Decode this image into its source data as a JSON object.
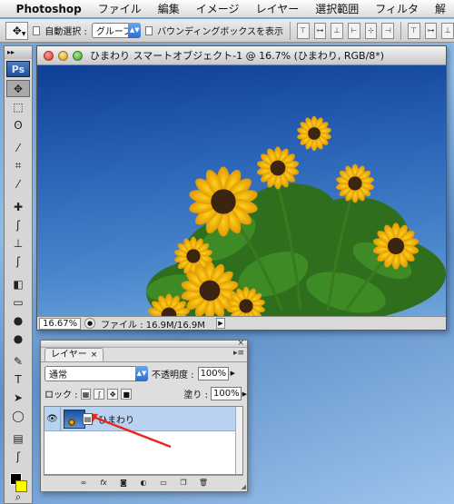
{
  "menubar": {
    "apple_icon": "apple-icon",
    "app_name": "Photoshop",
    "items": [
      "ファイル",
      "編集",
      "イメージ",
      "レイヤー",
      "選択範囲",
      "フィルタ",
      "解"
    ]
  },
  "options_bar": {
    "auto_select_label": "自動選択 :",
    "auto_select_value": "グループ",
    "bounding_box_label": "バウンディングボックスを表示"
  },
  "toolbox": {
    "logo": "Ps",
    "tools": [
      {
        "name": "move-tool",
        "glyph": "✥"
      },
      {
        "name": "marquee-tool",
        "glyph": "⬚"
      },
      {
        "name": "lasso-tool",
        "glyph": "ʘ"
      },
      {
        "name": "magic-wand-tool",
        "glyph": "⁄"
      },
      {
        "name": "crop-tool",
        "glyph": "⌗"
      },
      {
        "name": "slice-tool",
        "glyph": "⁄"
      },
      {
        "name": "healing-brush-tool",
        "glyph": "✚"
      },
      {
        "name": "brush-tool",
        "glyph": "ʃ"
      },
      {
        "name": "stamp-tool",
        "glyph": "⊥"
      },
      {
        "name": "history-brush-tool",
        "glyph": "ʃ"
      },
      {
        "name": "eraser-tool",
        "glyph": "◧"
      },
      {
        "name": "gradient-tool",
        "glyph": "▭"
      },
      {
        "name": "blur-tool",
        "glyph": "●"
      },
      {
        "name": "dodge-tool",
        "glyph": "●"
      },
      {
        "name": "pen-tool",
        "glyph": "✎"
      },
      {
        "name": "type-tool",
        "glyph": "T"
      },
      {
        "name": "path-selection-tool",
        "glyph": "➤"
      },
      {
        "name": "shape-tool",
        "glyph": "◯"
      },
      {
        "name": "notes-tool",
        "glyph": "▤"
      },
      {
        "name": "eyedropper-tool",
        "glyph": "ʃ"
      },
      {
        "name": "hand-tool",
        "glyph": "✋"
      },
      {
        "name": "zoom-tool",
        "glyph": "⌕"
      }
    ],
    "foreground_color": "#000000",
    "background_color": "#ffff00"
  },
  "document": {
    "title": "ひまわり スマートオブジェクト-1 @ 16.7% (ひまわり, RGB/8*)",
    "zoom": "16.67%",
    "file_info": "ファイル : 16.9M/16.9M"
  },
  "layers_panel": {
    "tab_label": "レイヤー",
    "blend_mode": "通常",
    "opacity_label": "不透明度 :",
    "opacity_value": "100%",
    "lock_label": "ロック :",
    "fill_label": "塗り :",
    "fill_value": "100%",
    "layer": {
      "name": "ひまわり",
      "visible": true,
      "smart_object": true
    },
    "bottom_buttons": [
      "link-icon",
      "fx-icon",
      "mask-icon",
      "adjustment-icon",
      "folder-icon",
      "new-layer-icon",
      "trash-icon"
    ]
  },
  "annotation": {
    "arrow_color": "#e8261c"
  }
}
